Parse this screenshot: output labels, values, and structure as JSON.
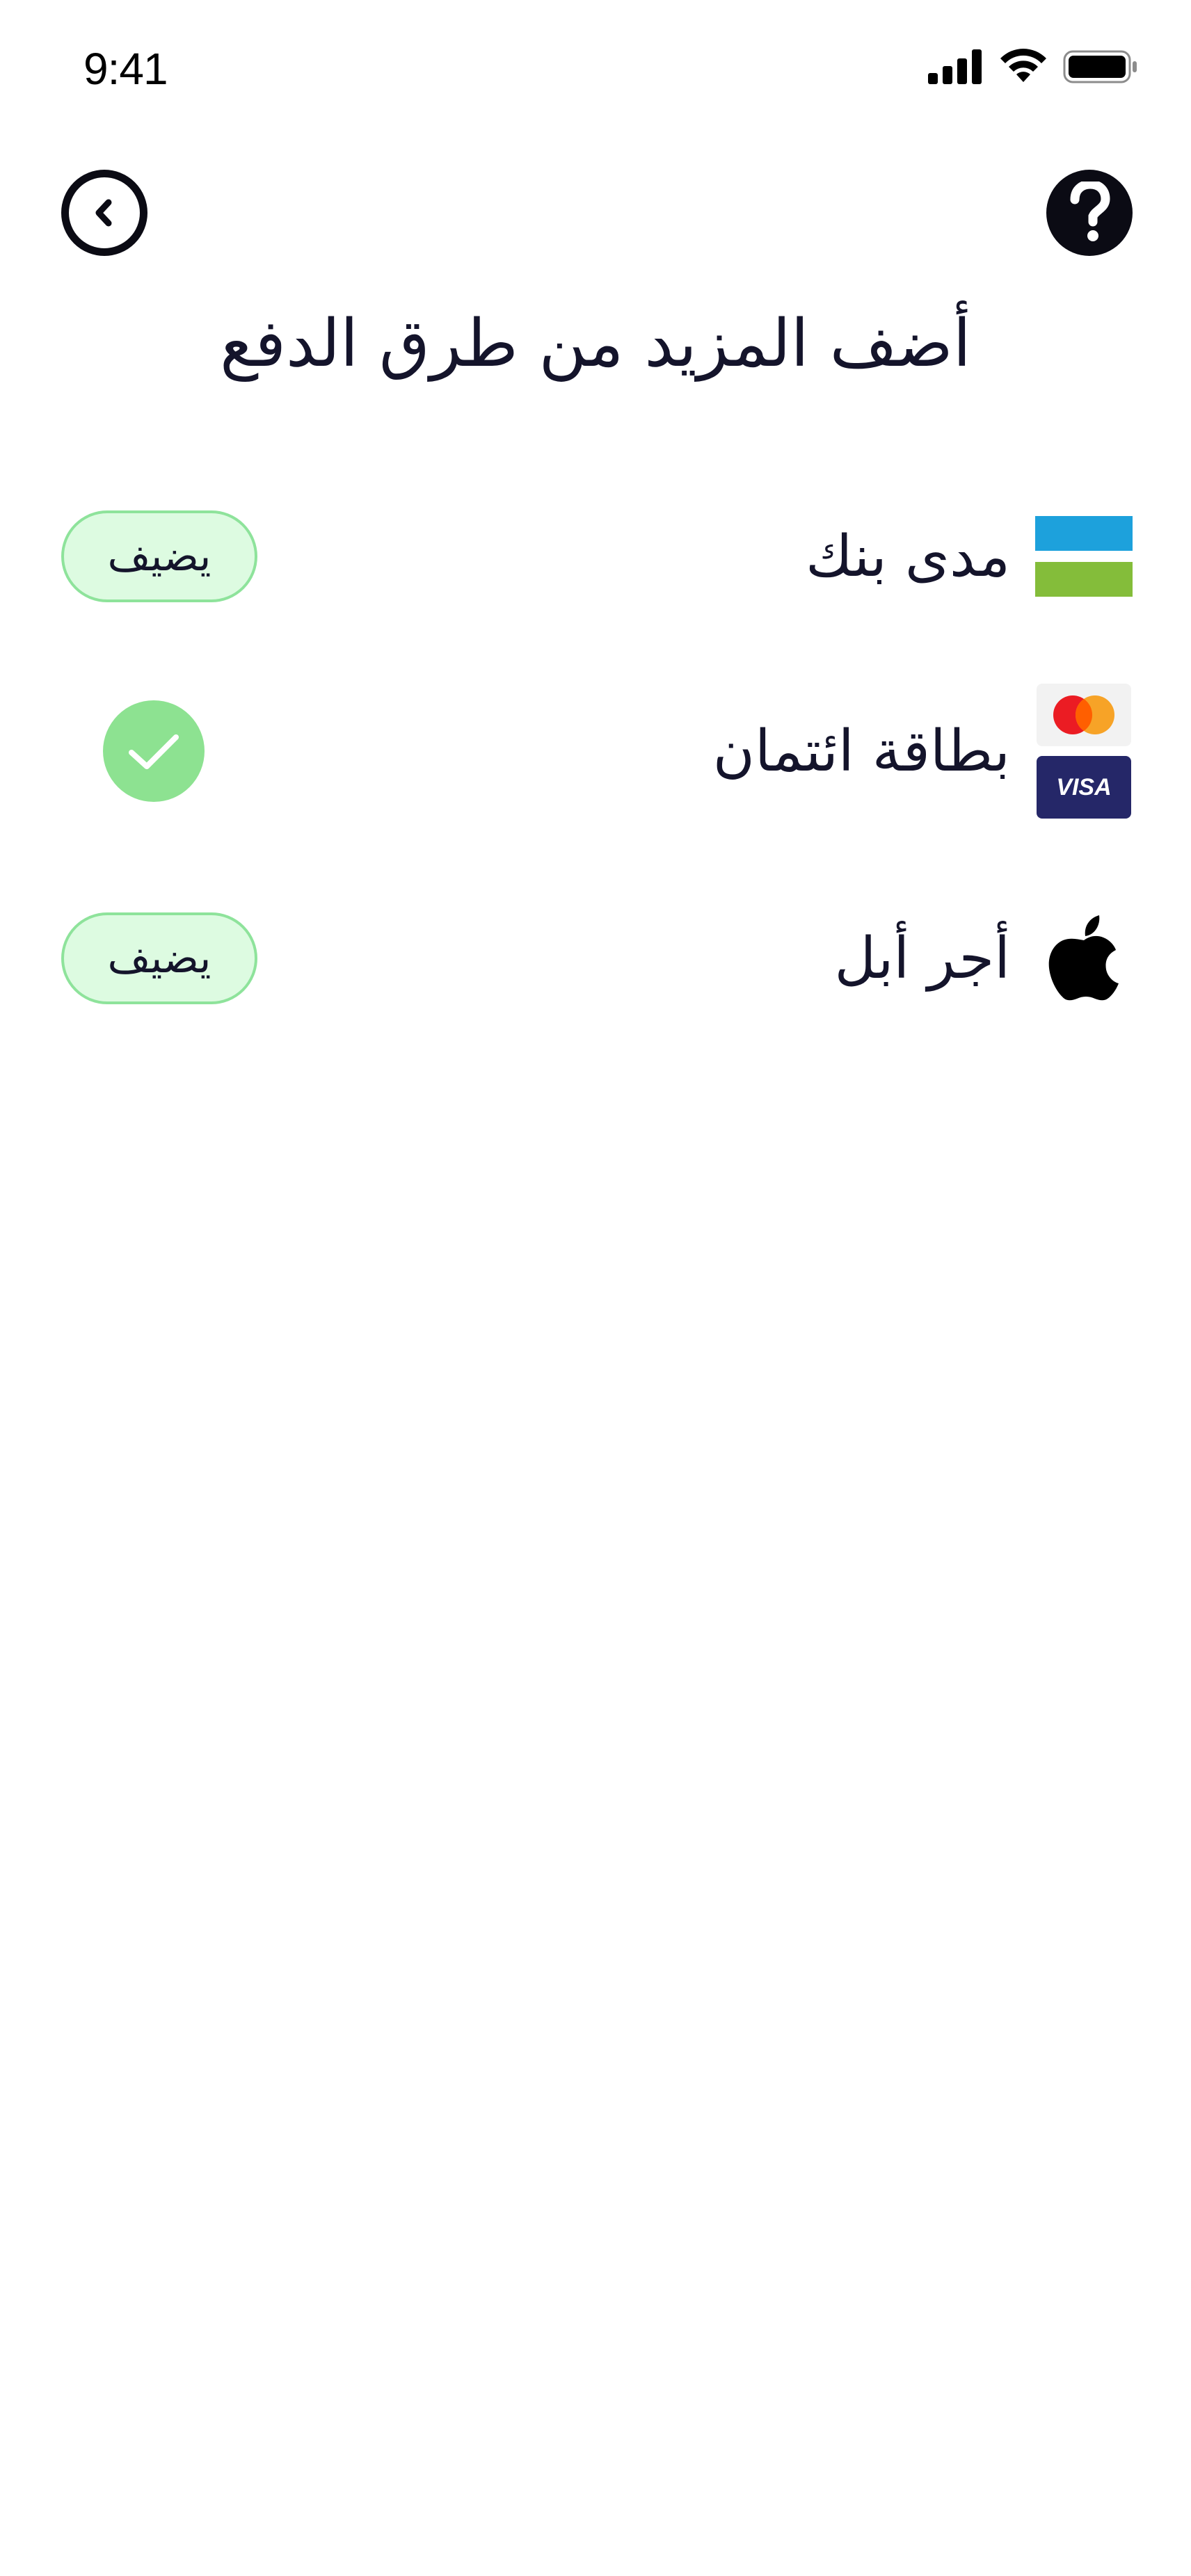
{
  "status_bar": {
    "time": "9:41"
  },
  "header": {
    "back_icon": "chevron-left-circle-icon",
    "help_icon": "question-circle-icon",
    "title": "أضف المزيد من طرق الدفع"
  },
  "methods": [
    {
      "label": "مدى بنك",
      "icon": "mada-logo",
      "status": "add",
      "action_label": "يضيف"
    },
    {
      "label": "بطاقة ائتمان",
      "icon": "mastercard-visa-logo",
      "status": "added",
      "visa_text": "VISA"
    },
    {
      "label": "أجر أبل",
      "icon": "apple-logo",
      "status": "add",
      "action_label": "يضيف"
    }
  ],
  "colors": {
    "add_bg": "#ddfbe1",
    "add_border": "#8ee39b",
    "check_bg": "#8de291",
    "mada_blue": "#1da1dc",
    "mada_green": "#84bd3a",
    "visa_bg": "#252768"
  }
}
